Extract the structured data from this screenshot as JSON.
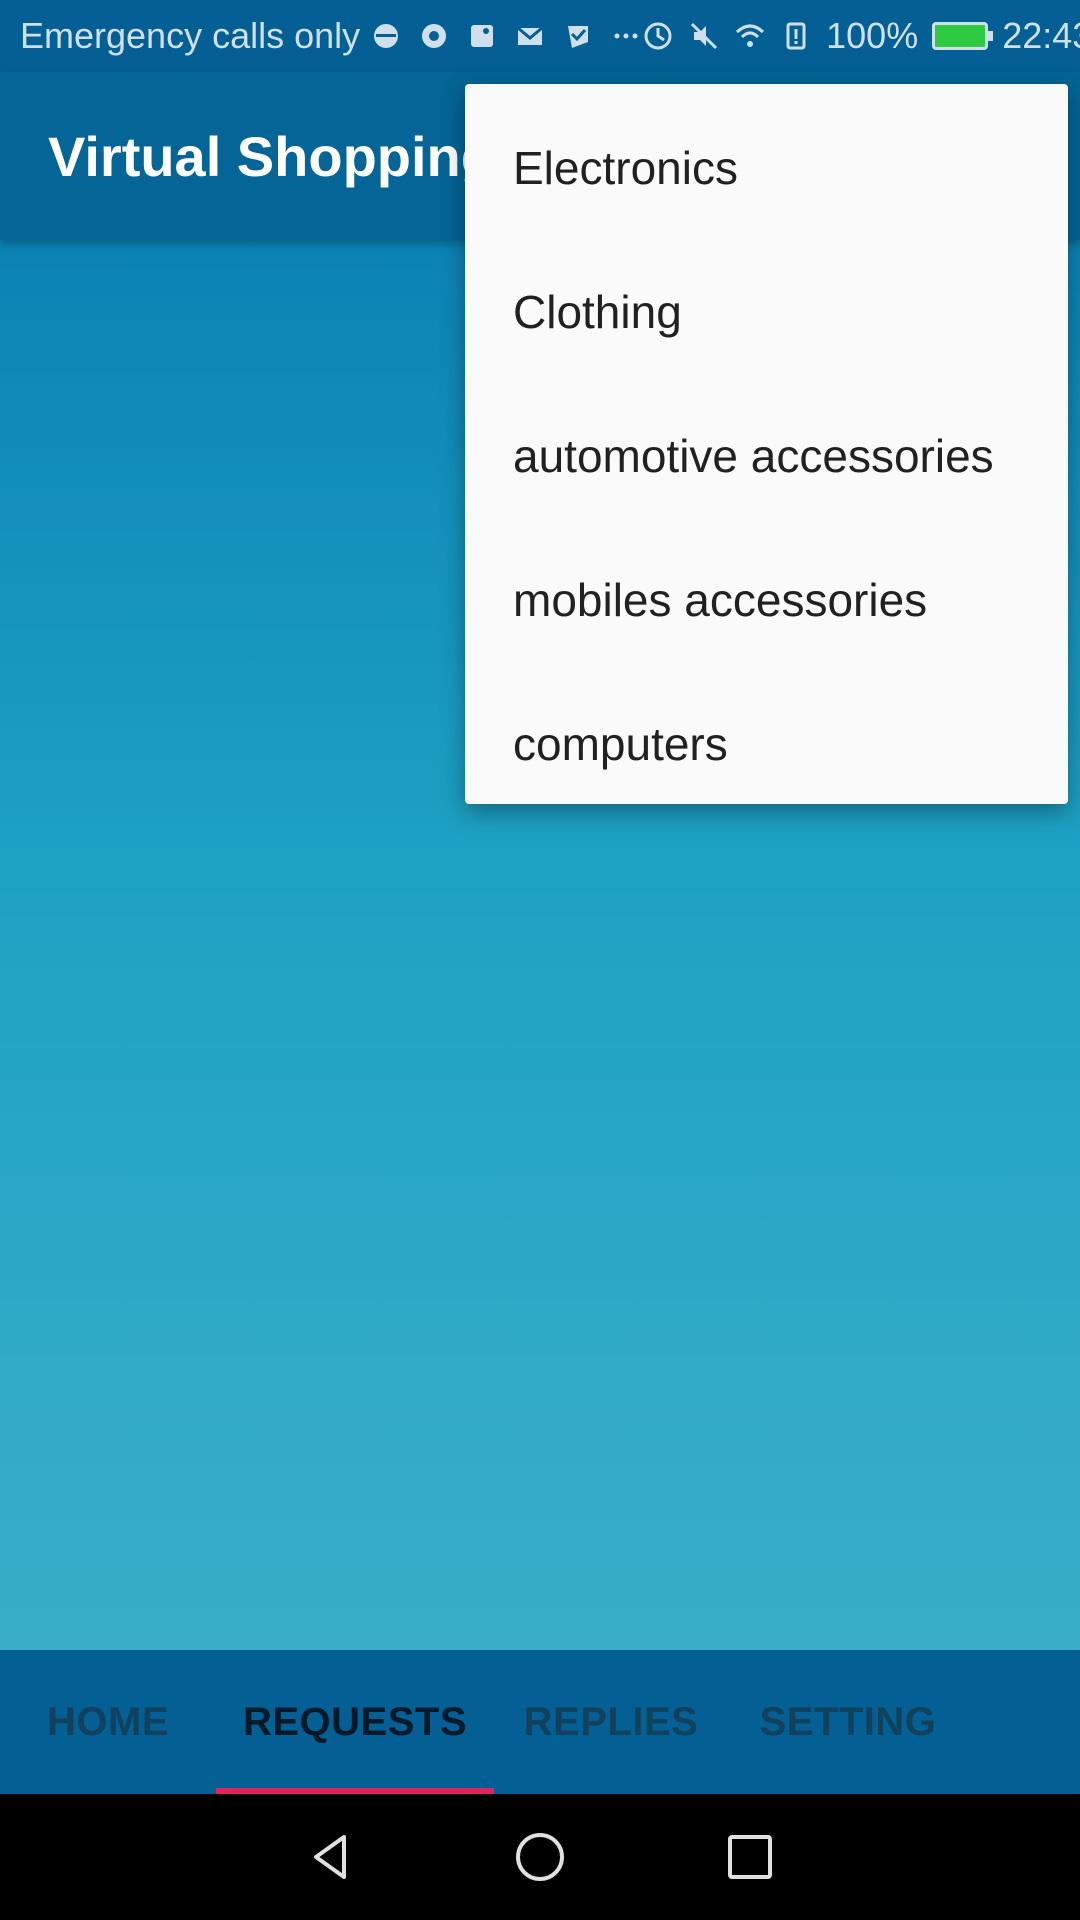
{
  "status_bar": {
    "carrier_text": "Emergency calls only",
    "battery_percent": "100%",
    "time": "22:43",
    "icons": [
      "face-icon",
      "chrome-icon",
      "maps-icon",
      "gmail-icon",
      "check-icon",
      "more-icon",
      "data-saver-icon",
      "mute-icon",
      "wifi-icon",
      "alert-sim-icon",
      "battery-icon"
    ]
  },
  "app_bar": {
    "title": "Virtual Shopping"
  },
  "dropdown": {
    "items": [
      "Electronics",
      "Clothing",
      "automotive accessories",
      "mobiles accessories",
      "computers"
    ]
  },
  "tabs": {
    "items": [
      "HOME",
      "REQUESTS",
      "REPLIES",
      "SETTING"
    ],
    "active": "REQUESTS",
    "indicator_color": "#e0245e"
  },
  "colors": {
    "primary": "#046596",
    "status_bar": "#035f94",
    "content_gradient_top": "#0b82b4",
    "content_gradient_bottom": "#3aaec8"
  }
}
